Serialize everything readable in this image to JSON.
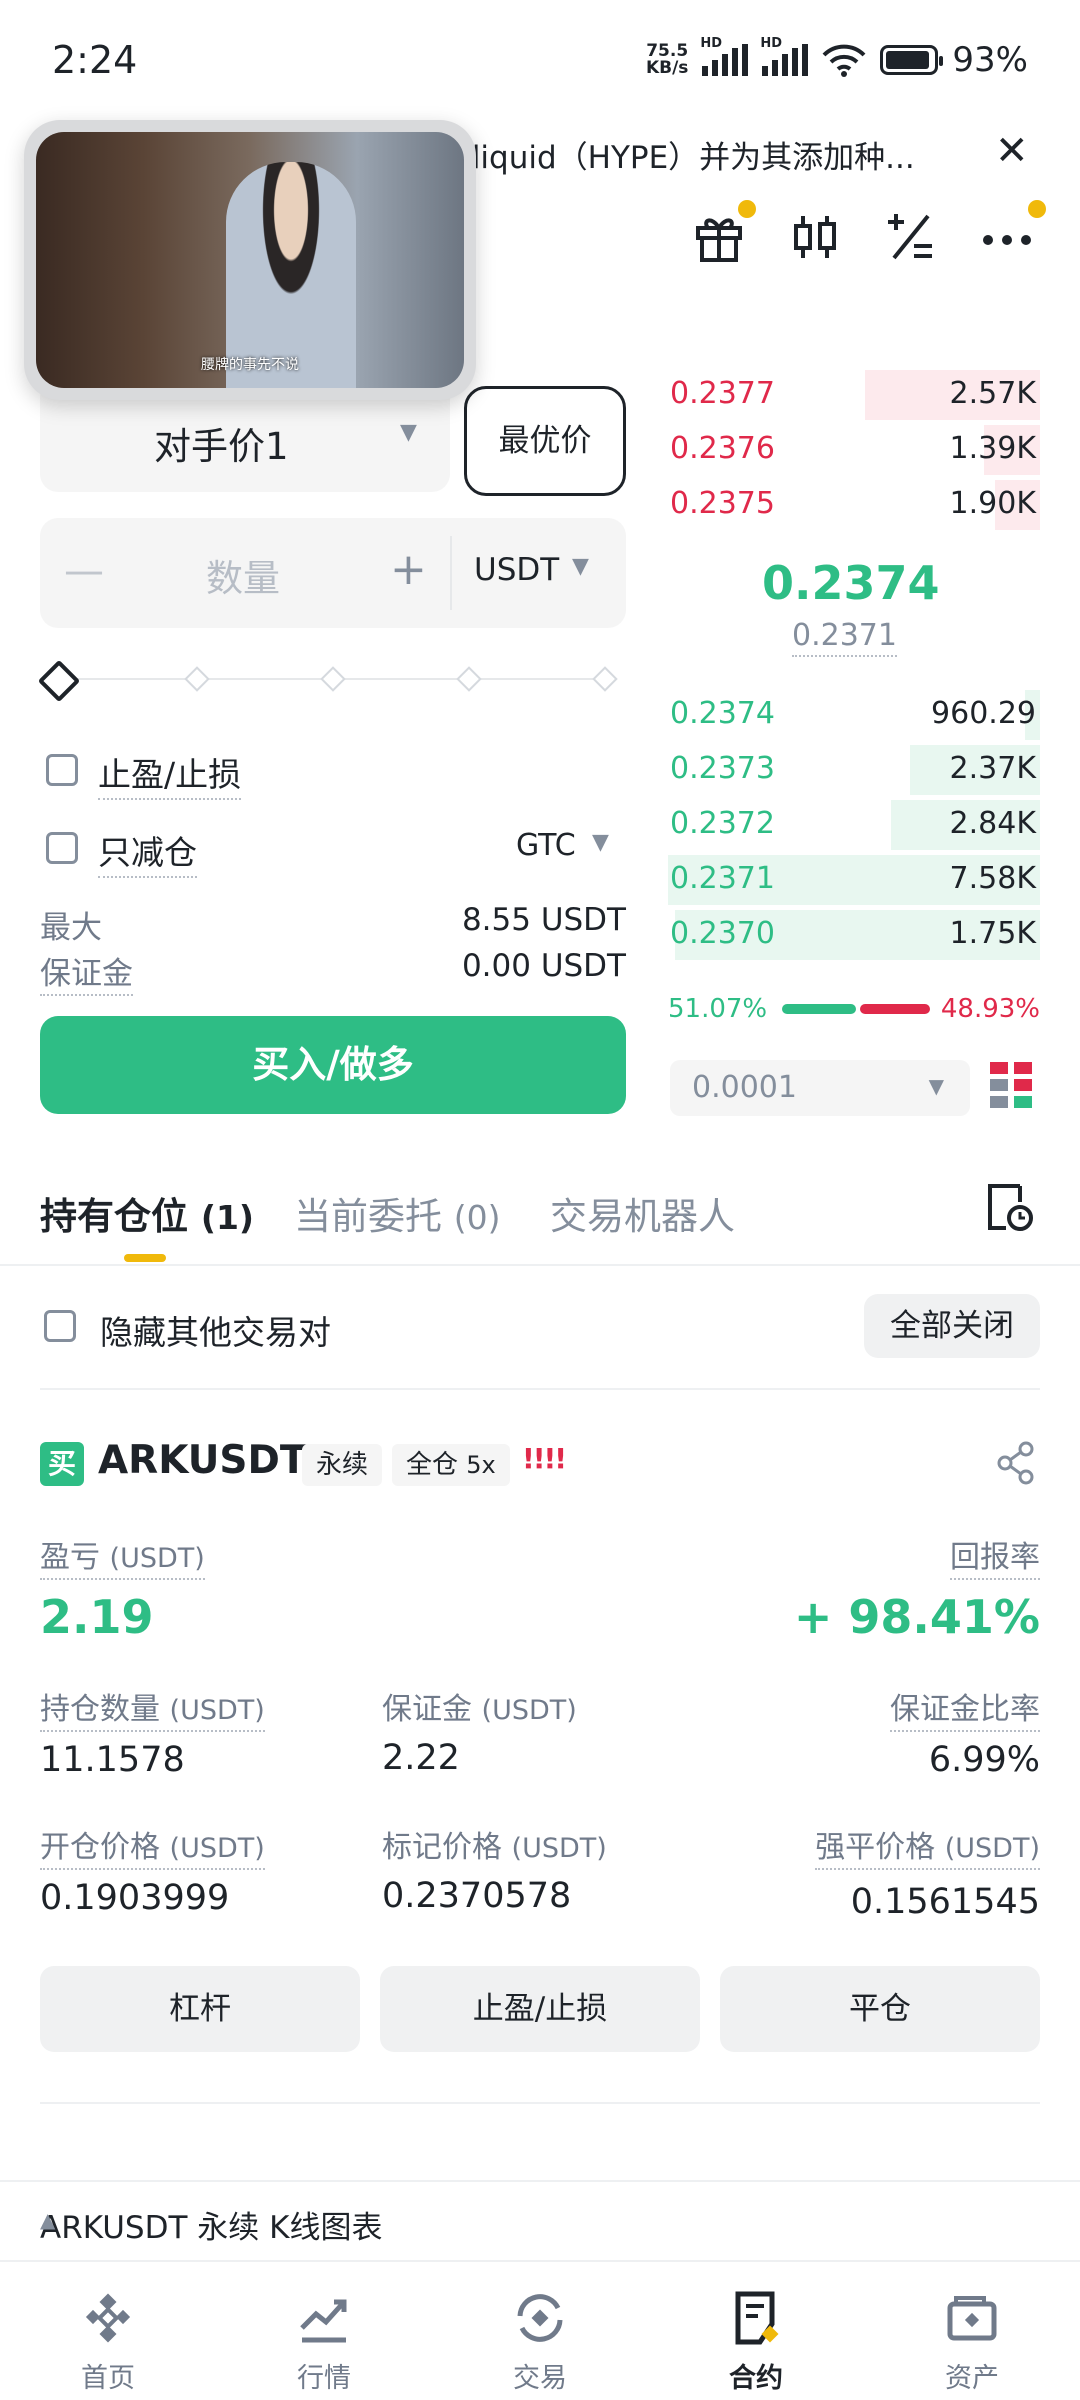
{
  "status_bar": {
    "time": "2:24",
    "net_speed_value": "75.5",
    "net_speed_unit": "KB/s",
    "sim1": "HD",
    "sim2": "HD",
    "battery": "93%"
  },
  "notice": {
    "text": "erliquid（HYPE）并为其添加种..."
  },
  "video_pip": {
    "subtitle": "腰牌的事先不说"
  },
  "header_icons": [
    "gift-icon",
    "candlestick-icon",
    "calculator-icon",
    "more-icon"
  ],
  "order_form": {
    "price_type": "对手价1",
    "best_price_label": "最优价",
    "quantity_placeholder": "数量",
    "minus": "—",
    "plus": "+",
    "unit": "USDT",
    "slider_percent": 0,
    "tpsl_label": "止盈/止损",
    "reduce_only_label": "只减仓",
    "time_in_force": "GTC",
    "max_label": "最大",
    "max_value": "8.55 USDT",
    "margin_label": "保证金",
    "margin_value": "0.00 USDT",
    "buy_button": "买入/做多"
  },
  "order_book": {
    "asks": [
      {
        "price": "0.2377",
        "qty": "2.57K",
        "depth": 0.47
      },
      {
        "price": "0.2376",
        "qty": "1.39K",
        "depth": 0.15
      },
      {
        "price": "0.2375",
        "qty": "1.90K",
        "depth": 0.12
      }
    ],
    "last_price": "0.2374",
    "mark_price": "0.2371",
    "bids": [
      {
        "price": "0.2374",
        "qty": "960.29",
        "depth": 0.04
      },
      {
        "price": "0.2373",
        "qty": "2.37K",
        "depth": 0.35
      },
      {
        "price": "0.2372",
        "qty": "2.84K",
        "depth": 0.4
      },
      {
        "price": "0.2371",
        "qty": "7.58K",
        "depth": 1.0
      },
      {
        "price": "0.2370",
        "qty": "1.75K",
        "depth": 0.98
      }
    ],
    "buy_ratio": "51.07%",
    "sell_ratio": "48.93%",
    "precision": "0.0001"
  },
  "tabs": {
    "positions": "持有仓位",
    "positions_count": "(1)",
    "open_orders": "当前委托",
    "open_orders_count": "(0)",
    "bots": "交易机器人"
  },
  "filter": {
    "hide_other_label": "隐藏其他交易对",
    "close_all": "全部关闭"
  },
  "position": {
    "side_tag": "买",
    "symbol": "ARKUSDT",
    "contract_type": "永续",
    "margin_mode": "全仓",
    "leverage": "5x",
    "warning": "!!!!",
    "pnl_label": "盈亏",
    "pnl_unit": "(USDT)",
    "pnl": "2.19",
    "roe_label": "回报率",
    "roe": "+ 98.41%",
    "size_label": "持仓数量",
    "size_unit": "(USDT)",
    "size": "11.1578",
    "margin_label": "保证金",
    "margin_unit": "(USDT)",
    "margin": "2.22",
    "margin_ratio_label": "保证金比率",
    "margin_ratio": "6.99%",
    "entry_label": "开仓价格",
    "entry_unit": "(USDT)",
    "entry": "0.1903999",
    "mark_label": "标记价格",
    "mark_unit": "(USDT)",
    "mark": "0.2370578",
    "liq_label": "强平价格",
    "liq_unit": "(USDT)",
    "liq": "0.1561545",
    "btn_leverage": "杠杆",
    "btn_tpsl": "止盈/止损",
    "btn_close": "平仓"
  },
  "kline_bar": {
    "label": "ARKUSDT 永续 K线图表"
  },
  "bottom_nav": [
    {
      "label": "首页",
      "icon": "home-icon"
    },
    {
      "label": "行情",
      "icon": "markets-icon"
    },
    {
      "label": "交易",
      "icon": "trade-icon"
    },
    {
      "label": "合约",
      "icon": "futures-icon",
      "active": true
    },
    {
      "label": "资产",
      "icon": "wallet-icon"
    }
  ],
  "colors": {
    "green": "#2ebd85",
    "red": "#e0294a",
    "accent": "#f0b90b"
  }
}
